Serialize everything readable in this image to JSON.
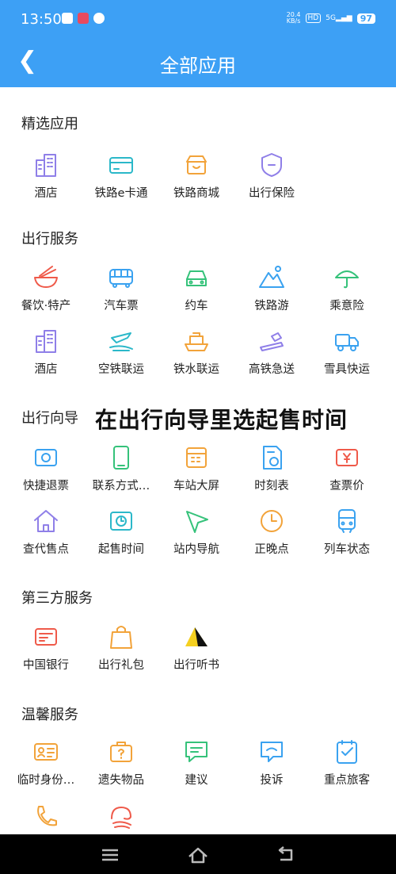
{
  "status_bar": {
    "time": "13:50",
    "net_speed_value": "20.4",
    "net_speed_unit": "KB/s",
    "hd": "HD",
    "network": "5G",
    "battery": "97"
  },
  "header": {
    "title": "全部应用"
  },
  "overlay_text": "在出行向导里选起售时间",
  "sections": [
    {
      "title": "精选应用",
      "items": [
        {
          "label": "酒店",
          "icon": "hotel-icon"
        },
        {
          "label": "铁路e卡通",
          "icon": "card-icon"
        },
        {
          "label": "铁路商城",
          "icon": "shop-icon"
        },
        {
          "label": "出行保险",
          "icon": "shield-icon"
        }
      ]
    },
    {
      "title": "出行服务",
      "items": [
        {
          "label": "餐饮·特产",
          "icon": "noodles-icon"
        },
        {
          "label": "汽车票",
          "icon": "bus-icon"
        },
        {
          "label": "约车",
          "icon": "car-icon"
        },
        {
          "label": "铁路游",
          "icon": "mountain-icon"
        },
        {
          "label": "乘意险",
          "icon": "umbrella-icon"
        },
        {
          "label": "酒店",
          "icon": "hotel-icon"
        },
        {
          "label": "空铁联运",
          "icon": "plane-train-icon"
        },
        {
          "label": "铁水联运",
          "icon": "ship-icon"
        },
        {
          "label": "高铁急送",
          "icon": "express-icon"
        },
        {
          "label": "雪具快运",
          "icon": "truck-icon"
        }
      ]
    },
    {
      "title": "出行向导",
      "items": [
        {
          "label": "快捷退票",
          "icon": "refund-icon"
        },
        {
          "label": "联系方式…",
          "icon": "phone-contact-icon"
        },
        {
          "label": "车站大屏",
          "icon": "screen-icon"
        },
        {
          "label": "时刻表",
          "icon": "timetable-icon"
        },
        {
          "label": "查票价",
          "icon": "price-icon"
        },
        {
          "label": "查代售点",
          "icon": "house-icon"
        },
        {
          "label": "起售时间",
          "icon": "clock-ticket-icon"
        },
        {
          "label": "站内导航",
          "icon": "navigation-icon"
        },
        {
          "label": "正晚点",
          "icon": "clock-icon"
        },
        {
          "label": "列车状态",
          "icon": "train-icon"
        }
      ]
    },
    {
      "title": "第三方服务",
      "items": [
        {
          "label": "中国银行",
          "icon": "bank-icon"
        },
        {
          "label": "出行礼包",
          "icon": "gift-bag-icon"
        },
        {
          "label": "出行听书",
          "icon": "audiobook-icon"
        }
      ]
    },
    {
      "title": "温馨服务",
      "items": [
        {
          "label": "临时身份…",
          "icon": "id-card-icon"
        },
        {
          "label": "遗失物品",
          "icon": "lost-item-icon"
        },
        {
          "label": "建议",
          "icon": "suggestion-icon"
        },
        {
          "label": "投诉",
          "icon": "complaint-icon"
        },
        {
          "label": "重点旅客",
          "icon": "checklist-icon"
        },
        {
          "label": "",
          "icon": "phone-icon"
        },
        {
          "label": "",
          "icon": "service-icon"
        }
      ]
    }
  ],
  "colors": {
    "header": "#3da0f5",
    "purple": "#8f7fe8",
    "blue": "#3aa2f0",
    "orange": "#f2a33a",
    "red": "#ef5a4a",
    "green": "#35c27a",
    "teal": "#2bb8c9"
  }
}
